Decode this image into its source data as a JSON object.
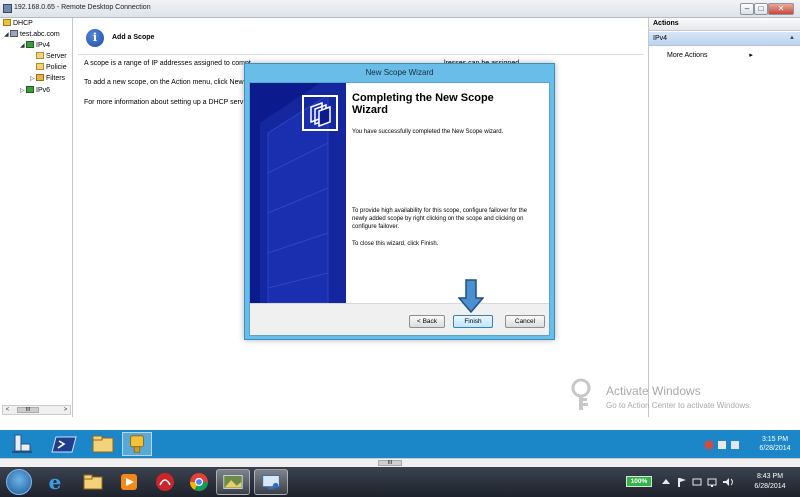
{
  "rdc": {
    "title": "192.168.0.65 - Remote Desktop Connection",
    "min_label": "–",
    "max_label": "□",
    "close_label": "✕"
  },
  "tree": {
    "items": [
      {
        "label": "DHCP",
        "icon": "dhcp-icon"
      },
      {
        "label": "test.abc.com",
        "icon": "server-icon"
      },
      {
        "label": "IPv4",
        "icon": "ipv4-icon"
      },
      {
        "label": "Server",
        "icon": "folder-icon"
      },
      {
        "label": "Policie",
        "icon": "folder-icon"
      },
      {
        "label": "Filters",
        "icon": "filter-icon"
      },
      {
        "label": "IPv6",
        "icon": "ipv6-icon"
      }
    ],
    "expand_collapsed": "▷",
    "expand_open": "◢",
    "scroll_left": "<",
    "scroll_right": ">",
    "scroll_thumb": "III"
  },
  "center": {
    "header": "Add a Scope",
    "line1a": "A scope is a range of IP addresses assigned to compt",
    "line1b": "lresses can be assigned.",
    "line2": "To add a new scope, on the Action menu, click New",
    "line3": "For more information about setting up a DHCP serv"
  },
  "actions": {
    "header": "Actions",
    "section": "IPv4",
    "collapse": "▲",
    "more_actions": "More Actions",
    "more_arrow": "▸"
  },
  "wizard": {
    "title": "New Scope Wizard",
    "heading_line1": "Completing the New Scope",
    "heading_line2": "Wizard",
    "done_text": "You have successfully completed the New Scope wizard.",
    "failover_text": "To provide high availability for this scope, configure failover for the newly added scope by right clicking on the scope and clicking on configure failover.",
    "close_text": "To close this wizard, click Finish.",
    "back_label": "< Back",
    "finish_label": "Finish",
    "cancel_label": "Cancel"
  },
  "watermark": {
    "line1": "Activate Windows",
    "line2": "Go to Action Center to activate Windows."
  },
  "inner_taskbar": {
    "time": "3:15 PM",
    "date": "6/28/2014"
  },
  "rdc_scroll": {
    "thumb": "III"
  },
  "outer_taskbar": {
    "battery": "100%",
    "time": "8:43 PM",
    "date": "6/28/2014"
  },
  "colors": {
    "wizard_banner": "#0b1b8d",
    "wizard_frame": "#68bde9",
    "inner_taskbar": "#1b87c9",
    "finish_arrow": "#4a8fd0"
  }
}
